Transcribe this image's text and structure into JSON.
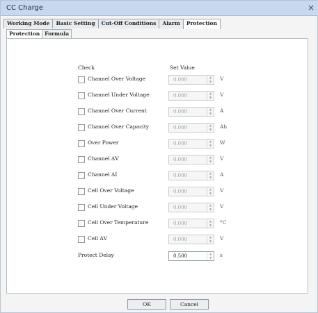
{
  "window": {
    "title": "CC Charge",
    "close_label": "×"
  },
  "tabs": [
    {
      "label": "Working Mode"
    },
    {
      "label": "Basic Setting"
    },
    {
      "label": "Cut-Off Conditions"
    },
    {
      "label": "Alarm"
    },
    {
      "label": "Protection"
    }
  ],
  "active_tab": "Protection",
  "subtabs": [
    {
      "label": "Protection"
    },
    {
      "label": "Formula"
    }
  ],
  "headers": {
    "check": "Check",
    "set_value": "Set Value"
  },
  "rows": [
    {
      "label": "Channel Over Voltage",
      "value": "0.000",
      "unit": "V"
    },
    {
      "label": "Channel Under Voltage",
      "value": "0.000",
      "unit": "V"
    },
    {
      "label": "Channel Over Current",
      "value": "0.000",
      "unit": "A"
    },
    {
      "label": "Channel Over Capacity",
      "value": "0.000",
      "unit": "Ah"
    },
    {
      "label": "Over Power",
      "value": "0.000",
      "unit": "W"
    },
    {
      "label": "Channel ΔV",
      "value": "0.000",
      "unit": "V"
    },
    {
      "label": "Channel ΔI",
      "value": "0.000",
      "unit": "A"
    },
    {
      "label": "Cell Over Voltage",
      "value": "0.000",
      "unit": "V"
    },
    {
      "label": "Cell Under Voltage",
      "value": "0.000",
      "unit": "V"
    },
    {
      "label": "Cell Over Temperature",
      "value": "0.000",
      "unit": "°C"
    },
    {
      "label": "Cell ΔV",
      "value": "0.000",
      "unit": "V"
    }
  ],
  "protect_delay": {
    "label": "Protect Delay",
    "value": "0.500",
    "unit": "s"
  },
  "buttons": {
    "ok": "OK",
    "cancel": "Cancel"
  },
  "icons": {
    "spin_up": "▲",
    "spin_down": "▼"
  }
}
